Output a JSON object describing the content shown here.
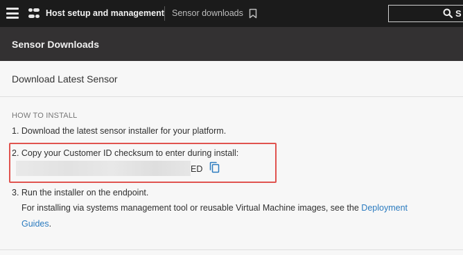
{
  "topbar": {
    "app_title": "Host setup and management",
    "breadcrumb": "Sensor downloads",
    "search_text": "S"
  },
  "page": {
    "title": "Sensor Downloads"
  },
  "card": {
    "title": "Download Latest Sensor",
    "section_label": "HOW TO INSTALL",
    "step1": "1. Download the latest sensor installer for your platform.",
    "step2": "2. Copy your Customer ID checksum to enter during install:",
    "checksum_suffix": "ED",
    "step3": "3. Run the installer on the endpoint.",
    "step3_note_prefix": "For installing via systems management tool or reusable Virtual Machine images, see the ",
    "step3_link_part1": "Deployment",
    "step3_link_part2": "Guides",
    "step3_note_suffix": "."
  },
  "colors": {
    "topbar_bg": "#1b1b1b",
    "header_bg": "#333132",
    "link": "#2b7bbf",
    "highlight_border": "#e0534f"
  },
  "icons": [
    "menu-icon",
    "app-logo-icon",
    "bookmark-icon",
    "search-icon",
    "copy-icon"
  ]
}
